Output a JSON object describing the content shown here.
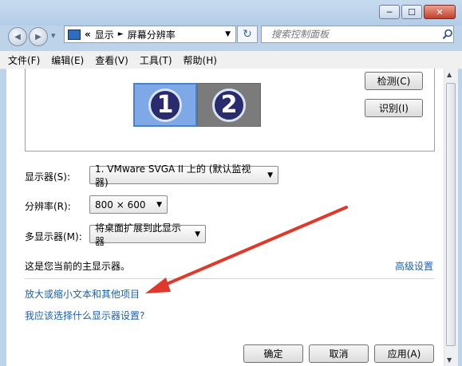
{
  "window": {
    "caption_buttons": [
      "─",
      "☐",
      "✕"
    ]
  },
  "nav": {
    "back_glyph": "◀",
    "forward_glyph": "▶",
    "history_glyph": "▾",
    "breadcrumb": [
      "显示",
      "屏幕分辨率"
    ],
    "breadcrumb_prefix": "«",
    "separator": "►",
    "refresh_glyph": "↻",
    "search_placeholder": "搜索控制面板"
  },
  "menu": [
    "文件(F)",
    "编辑(E)",
    "查看(V)",
    "工具(T)",
    "帮助(H)"
  ],
  "preview": {
    "monitors": [
      "1",
      "2"
    ],
    "detect_label": "检测(C)",
    "identify_label": "识别(I)"
  },
  "settings": {
    "display_label": "显示器(S):",
    "display_value": "1. VMware SVGA II 上的 (默认监视器)",
    "resolution_label": "分辨率(R):",
    "resolution_value": "800 × 600",
    "multi_label": "多显示器(M):",
    "multi_value": "将桌面扩展到此显示器"
  },
  "main_display_text": "这是您当前的主显示器。",
  "advanced_link": "高级设置",
  "links": [
    "放大或缩小文本和其他项目",
    "我应该选择什么显示器设置?"
  ],
  "footer": {
    "ok": "确定",
    "cancel": "取消",
    "apply": "应用(A)"
  },
  "colors": {
    "link": "#1b5fb3",
    "annotation_arrow": "#e0392b"
  }
}
